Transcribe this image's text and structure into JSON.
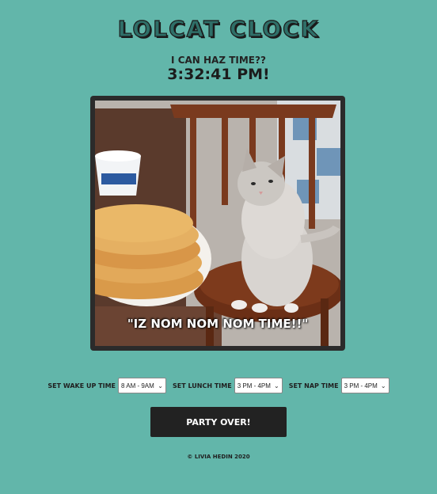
{
  "header": {
    "title": "LOLCAT CLOCK",
    "subtitle": "I CAN HAZ TIME??",
    "clock": "3:32:41 PM!"
  },
  "photo": {
    "caption": "\"IZ NOM NOM NOM TIME!!\""
  },
  "controls": [
    {
      "label": "SET WAKE UP TIME",
      "value": "8 AM - 9AM"
    },
    {
      "label": "SET LUNCH TIME",
      "value": "3 PM - 4PM"
    },
    {
      "label": "SET NAP TIME",
      "value": "3 PM - 4PM"
    }
  ],
  "button": {
    "label": "PARTY OVER!"
  },
  "footer": {
    "text": "© LIVIA HEDIN 2020"
  },
  "colors": {
    "background": "#62b6aa",
    "button": "#222222",
    "title": "#2f6f68"
  }
}
